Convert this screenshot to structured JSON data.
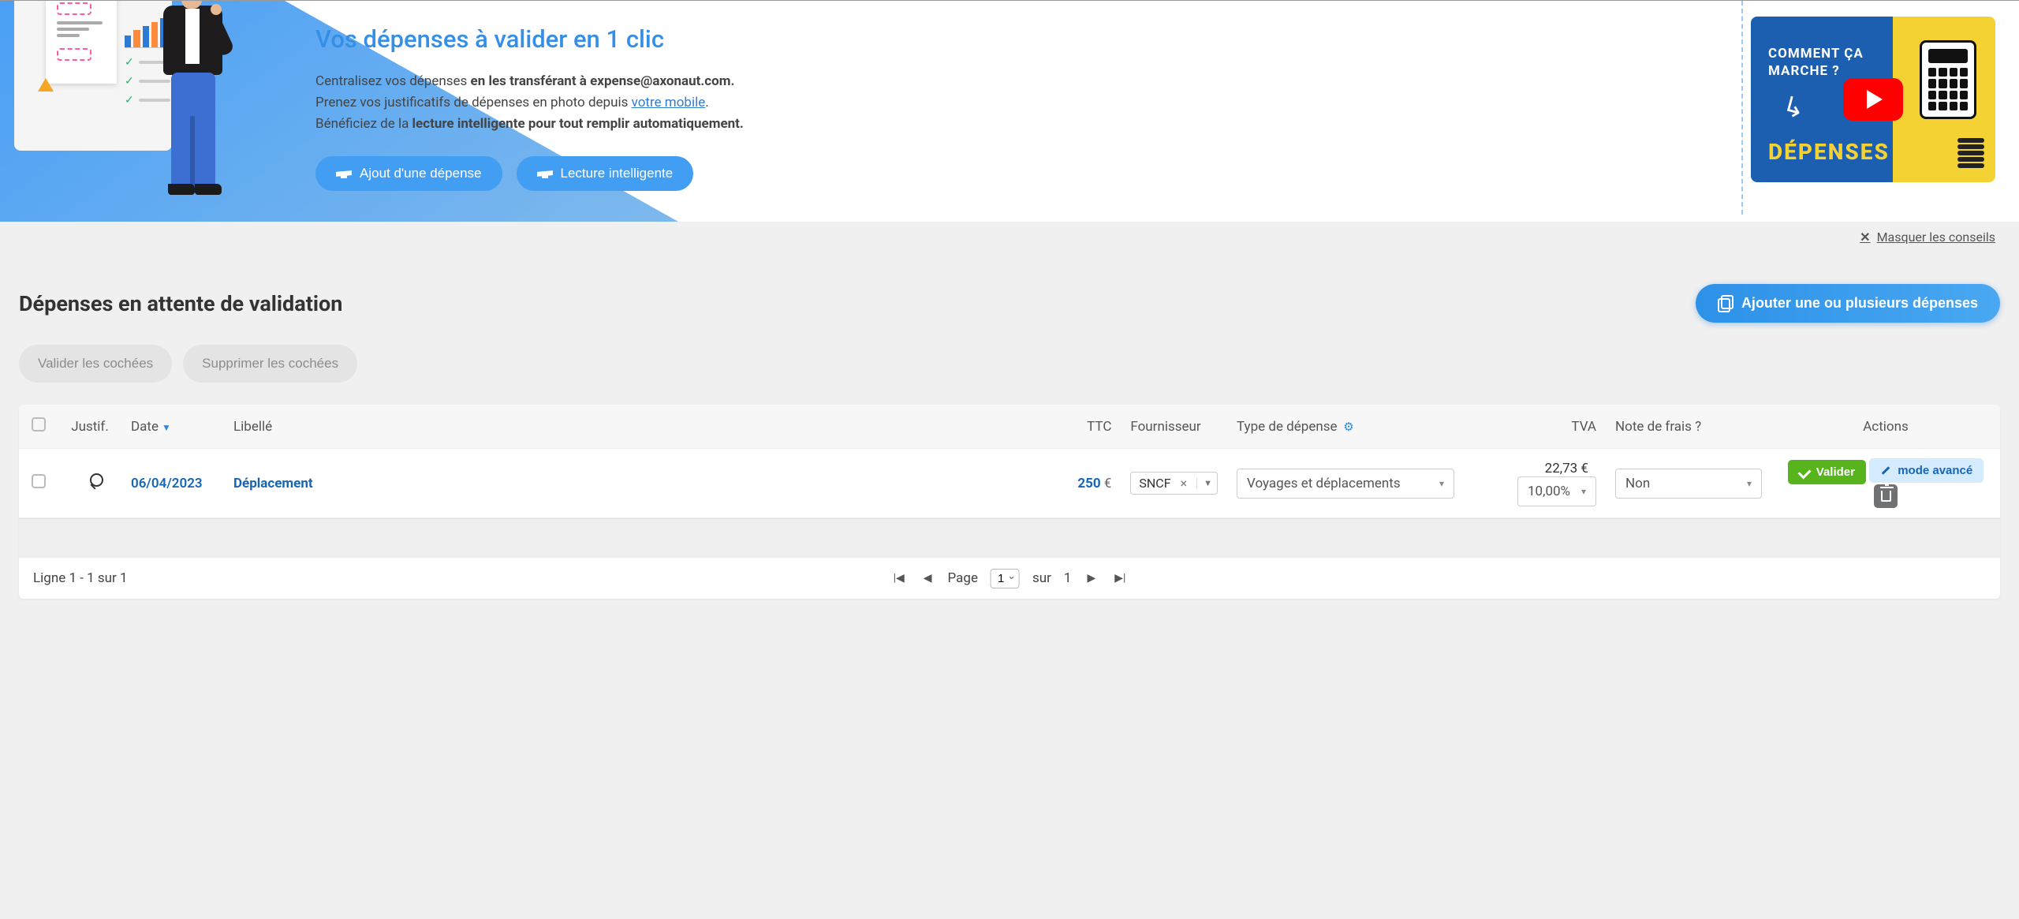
{
  "hero": {
    "title": "Vos dépenses à valider en 1 clic",
    "line1_pre": "Centralisez vos dépenses ",
    "line1_bold": "en les transférant à expense@axonaut.com.",
    "line2_pre": "Prenez vos justificatifs de dépenses en photo depuis ",
    "line2_link": "votre mobile",
    "line2_post": ".",
    "line3_pre": "Bénéficiez de la ",
    "line3_bold": "lecture intelligente pour tout remplir automatiquement.",
    "btn_add": "Ajout d'une dépense",
    "btn_smart": "Lecture intelligente",
    "video_l1": "COMMENT ÇA",
    "video_l2": "MARCHE ?",
    "video_big": "DÉPENSES",
    "hide_tips": "Masquer les conseils"
  },
  "page": {
    "title": "Dépenses en attente de validation",
    "add_button": "Ajouter une ou plusieurs dépenses",
    "validate_checked": "Valider les cochées",
    "delete_checked": "Supprimer les cochées"
  },
  "table": {
    "headers": {
      "justif": "Justif.",
      "date": "Date",
      "libelle": "Libellé",
      "ttc": "TTC",
      "fournisseur": "Fournisseur",
      "type": "Type de dépense",
      "tva": "TVA",
      "note": "Note de frais ?",
      "actions": "Actions"
    },
    "row": {
      "date": "06/04/2023",
      "libelle": "Déplacement",
      "ttc_amount": "250",
      "ttc_cur": " €",
      "fournisseur": "SNCF",
      "type": "Voyages et déplacements",
      "tva_amount": "22,73 €",
      "tva_rate": "10,00%",
      "note": "Non",
      "validate": "Valider",
      "advanced": "mode avancé"
    }
  },
  "pager": {
    "summary": "Ligne 1 - 1 sur 1",
    "page_label": "Page",
    "page_value": "1",
    "sur": "sur",
    "total": "1"
  }
}
